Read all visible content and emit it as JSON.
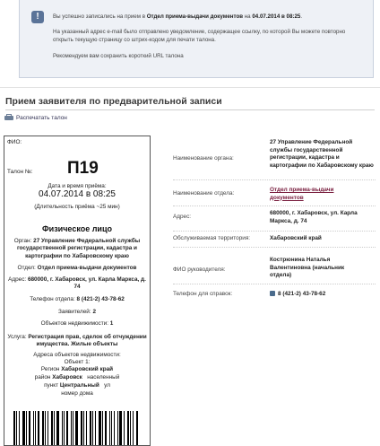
{
  "notice": {
    "icon": "info-icon",
    "line1_prefix": "Вы успешно записались на прием в ",
    "line1_org": "Отдел приема-выдачи документов",
    "line1_mid": " на ",
    "line1_datetime": "04.07.2014 в 08:25",
    "line1_end": ".",
    "line2": "На указанный адрес e-mail было отправлено уведомление, содержащее ссылку, по которой Вы можете повторно открыть текущую страницу со штрих-кодом для печати талона.",
    "line3": "Рекомендуем вам сохранить короткий URL талона"
  },
  "page_title": "Прием заявителя по предварительной записи",
  "print_label": "Распечатать талон",
  "ticket": {
    "fio_label": "ФИО:",
    "talon_label": "Талон №:",
    "talon_number": "П19",
    "datetime_label": "Дата и время приёма:",
    "datetime_value": "04.07.2014 в 08:25",
    "duration": "(Длительность приёма ~25 мин)",
    "section_title": "Физическое лицо",
    "organ_label": "Орган:",
    "organ_value": "27 Управление Федеральной службы государственной регистрации, кадастра и картографии по Хабаровскому краю",
    "dept_label": "Отдел:",
    "dept_value": "Отдел приема-выдачи документов",
    "address_label": "Адрес:",
    "address_value": "680000, г. Хабаровск, ул. Карла Маркса, д. 74",
    "phone_label": "Телефон отдела:",
    "phone_value": "8 (421-2) 43-78-62",
    "applicants_label": "Заявителей:",
    "applicants_value": "2",
    "objects_label": "Объектов недвижимости:",
    "objects_value": "1",
    "service_label": "Услуга:",
    "service_value": "Регистрация прав, сделок об отчуждении имущества. Жилые объекты",
    "obj_addr_label": "Адреса объектов недвижимости:",
    "obj_label": "Объект 1:",
    "region_label": "Регион",
    "region_value": "Хабаровский край",
    "district_label": "район",
    "district_value": "Хабаровск",
    "district_suffix": "населенный",
    "point_label": "пункт",
    "point_value": "Центральный",
    "street_label": "ул",
    "house_label": "номер дома"
  },
  "details": [
    {
      "label": "Наименование органа:",
      "value": "27 Управление Федеральной службы государственной регистрации, кадастра и картографии по Хабаровскому краю"
    },
    {
      "label": "Наименование отдела:",
      "value": "Отдел приема-выдачи документов"
    },
    {
      "label": "Адрес:",
      "value": "680000, г. Хабаровск, ул. Карла Маркса, д. 74"
    },
    {
      "label": "Обслуживаемая территория:",
      "value": "Хабаровский край"
    },
    {
      "label": "ФИО руководителя:",
      "value": "Кострюнина Наталья Валентиновна (начальник отдела)"
    },
    {
      "label": "Телефон для справок:",
      "value": "8 (421-2) 43-78-62"
    }
  ]
}
